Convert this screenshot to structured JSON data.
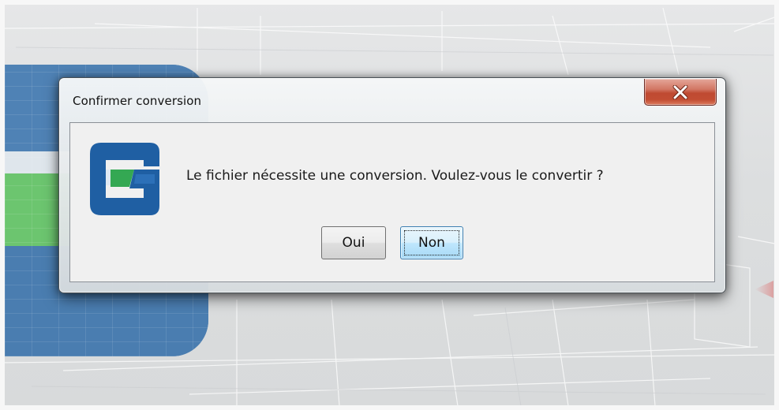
{
  "dialog": {
    "title": "Confirmer conversion",
    "message": "Le fichier nécessite une conversion. Voulez-vous le convertir ?",
    "buttons": {
      "yes_label": "Oui",
      "no_label": "Non",
      "focused": "no"
    },
    "close_icon": "close-icon",
    "app_icon": "app-logo-icon"
  },
  "colors": {
    "close_button": "#c24d33",
    "default_button": "#a7d9f5",
    "logo_blue": "#1f5fa3",
    "logo_green": "#34a853",
    "panel_blue": "#4f82b5",
    "panel_green": "#6cc56f"
  }
}
